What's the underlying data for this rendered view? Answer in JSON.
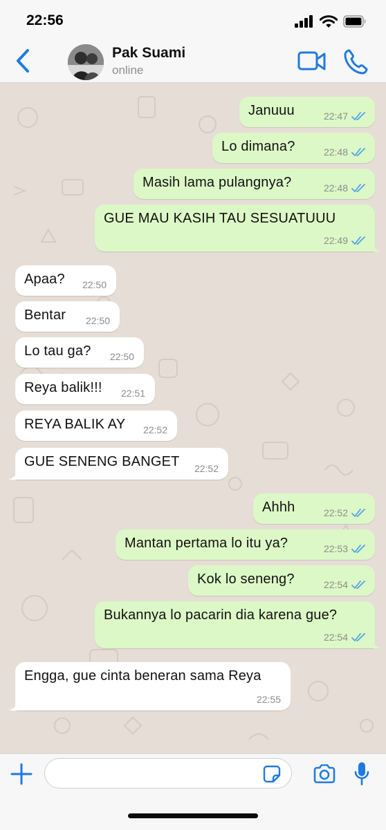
{
  "status_bar": {
    "time": "22:56"
  },
  "header": {
    "contact_name": "Pak Suami",
    "contact_status": "online",
    "icons": [
      "back-chevron-icon",
      "video-camera-icon",
      "phone-icon"
    ],
    "accent_color": "#1f7ae0"
  },
  "chat": {
    "colors": {
      "background": "#e6ded6",
      "outgoing": "#dcf8c6",
      "incoming": "#ffffff",
      "read_ticks": "#4fa3e8"
    },
    "messages": [
      {
        "dir": "out",
        "text": "Januuu",
        "time": "22:47",
        "status": "read"
      },
      {
        "dir": "out",
        "text": "Lo dimana?",
        "time": "22:48",
        "status": "read"
      },
      {
        "dir": "out",
        "text": "Masih lama pulangnya?",
        "time": "22:48",
        "status": "read"
      },
      {
        "dir": "out",
        "text": "GUE MAU KASIH TAU SESUATUUU",
        "time": "22:49",
        "status": "read"
      },
      {
        "dir": "in",
        "text": "Apaa?",
        "time": "22:50"
      },
      {
        "dir": "in",
        "text": "Bentar",
        "time": "22:50"
      },
      {
        "dir": "in",
        "text": "Lo tau ga?",
        "time": "22:50"
      },
      {
        "dir": "in",
        "text": "Reya balik!!!",
        "time": "22:51"
      },
      {
        "dir": "in",
        "text": "REYA BALIK AY",
        "time": "22:52"
      },
      {
        "dir": "in",
        "text": "GUE SENENG BANGET",
        "time": "22:52"
      },
      {
        "dir": "out",
        "text": "Ahhh",
        "time": "22:52",
        "status": "read"
      },
      {
        "dir": "out",
        "text": "Mantan pertama lo itu ya?",
        "time": "22:53",
        "status": "read"
      },
      {
        "dir": "out",
        "text": "Kok lo seneng?",
        "time": "22:54",
        "status": "read"
      },
      {
        "dir": "out",
        "text": "Bukannya lo pacarin dia karena gue?",
        "time": "22:54",
        "status": "read"
      },
      {
        "dir": "in",
        "text": "Engga, gue cinta beneran sama Reya",
        "time": "22:55"
      }
    ]
  },
  "input_bar": {
    "message_value": "",
    "icons": [
      "plus-icon",
      "sticker-icon",
      "camera-icon",
      "microphone-icon"
    ]
  }
}
